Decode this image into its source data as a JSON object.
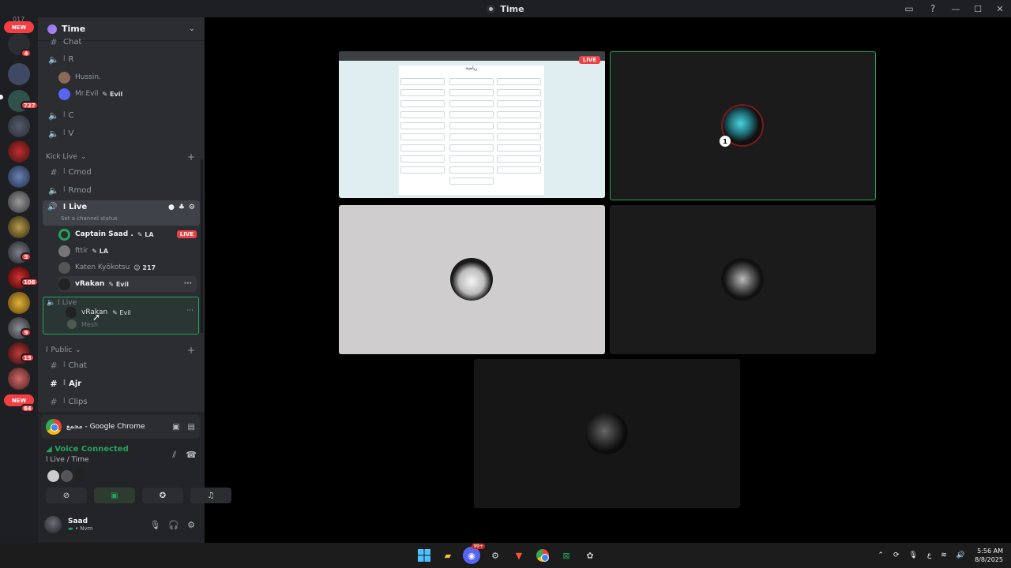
{
  "window": {
    "title": "Time"
  },
  "rail": {
    "top_fragment": "017",
    "new_badge_top": "NEW",
    "new_badge_bottom": "NEW",
    "badges": [
      "4",
      "727",
      "5",
      "106",
      "9",
      "15",
      "84"
    ]
  },
  "sidebar": {
    "server_name": "Time",
    "top_cut_channel": "Chat",
    "channels_top": [
      {
        "label": "R"
      },
      {
        "label": "C"
      },
      {
        "label": "V"
      }
    ],
    "users_r": [
      {
        "name": "Hussin."
      },
      {
        "name": "Mr.Evil",
        "tag": "Evil"
      }
    ],
    "category_kick": "Kick Live",
    "kick_channels": [
      "Cmod",
      "Rmod"
    ],
    "live_channel": {
      "label": "Live",
      "status_hint": "Set a channel status"
    },
    "live_users": [
      {
        "name": "Captain Saad .",
        "tag": "LA",
        "live": "LIVE"
      },
      {
        "name": "fttir",
        "tag": "LA"
      },
      {
        "name": "Katen Kyōkotsu",
        "tag": "217"
      },
      {
        "name": "vRakan",
        "tag": "Evil"
      }
    ],
    "drag_channel": "Live",
    "drag_user": "vRakan",
    "drag_tag": "Evil",
    "drag_under": "Mesh",
    "category_public": "Public",
    "public_channels": [
      "Chat",
      "Ajr",
      "Clips"
    ]
  },
  "voice": {
    "app_label": "مجمع - Google Chrome",
    "status": "Voice Connected",
    "channel": "Live / Time"
  },
  "user": {
    "name": "Saad",
    "status": "Nvm"
  },
  "stage": {
    "live_badge": "LIVE",
    "stream_title": "رياضة"
  },
  "taskbar": {
    "time": "5:56 AM",
    "date": "8/8/2025",
    "lang": "ع",
    "discord_badge": "99+"
  },
  "colors": {
    "accent_green": "#23a559",
    "live_red": "#ed4245",
    "sidebar_bg": "#2b2d31",
    "rail_bg": "#1e1f22"
  }
}
